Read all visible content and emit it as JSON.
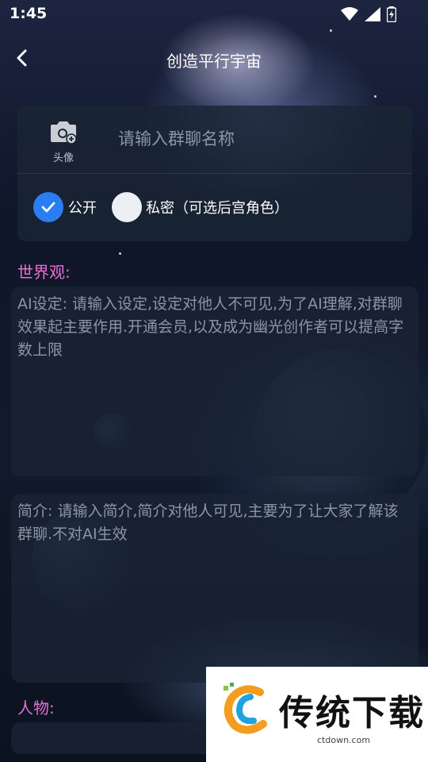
{
  "status_bar": {
    "time": "1:45"
  },
  "nav": {
    "title": "创造平行宇宙"
  },
  "group": {
    "avatar_label": "头像",
    "name_placeholder": "请输入群聊名称",
    "visibility": {
      "public_label": "公开",
      "private_label": "私密（可选后宫角色）",
      "selected": "public"
    }
  },
  "worldview": {
    "label": "世界观:",
    "placeholder": "AI设定: 请输入设定,设定对他人不可见,为了AI理解,对群聊效果起主要作用.开通会员,以及成为幽光创作者可以提高字数上限"
  },
  "intro": {
    "placeholder": "简介: 请输入简介,简介对他人可见,主要为了让大家了解该群聊.不对AI生效"
  },
  "characters": {
    "label": "人物:"
  },
  "watermark": {
    "text": "传统下载",
    "url": "ctdown.com"
  },
  "colors": {
    "accent": "#2b7ef2",
    "section_label": "#ea6fd5",
    "card": "#1a2434"
  }
}
